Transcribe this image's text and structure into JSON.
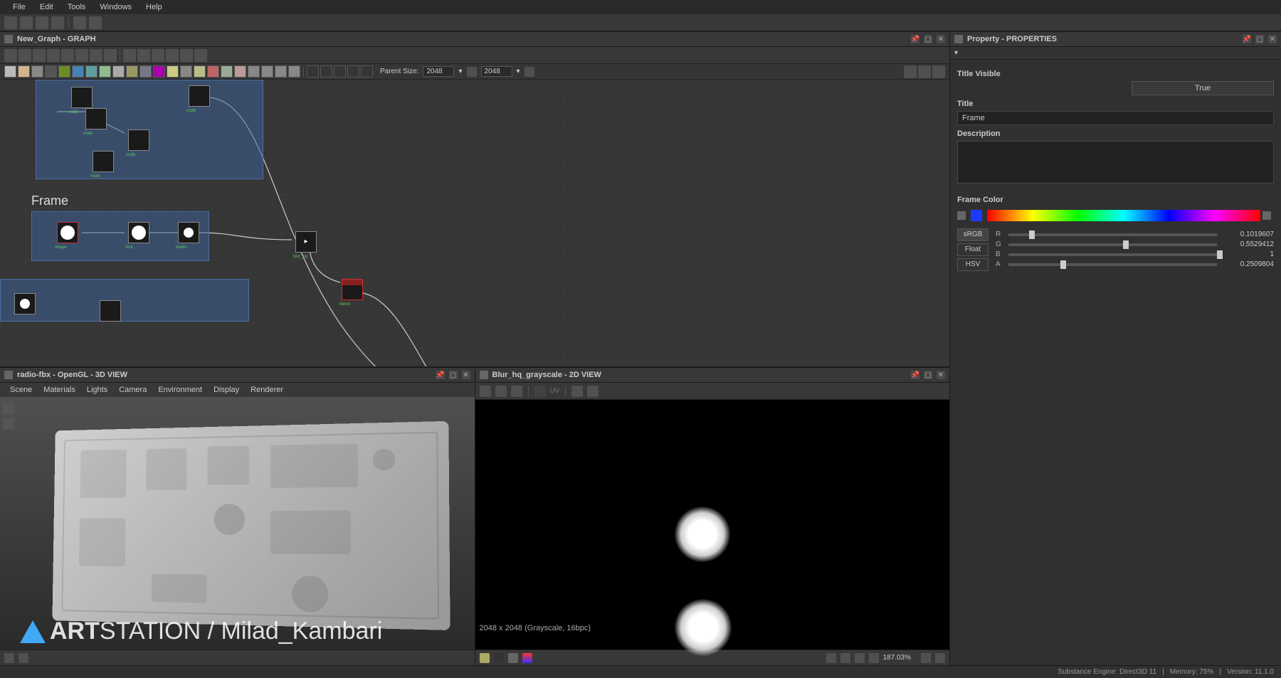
{
  "menubar": [
    "File",
    "Edit",
    "Tools",
    "Windows",
    "Help"
  ],
  "graph": {
    "title": "New_Graph - GRAPH",
    "parent_size_label": "Parent Size:",
    "size_w": "2048",
    "size_h": "2048",
    "frame_title": "Frame"
  },
  "view3d": {
    "title": "radio-fbx - OpenGL - 3D VIEW",
    "menus": [
      "Scene",
      "Materials",
      "Lights",
      "Camera",
      "Environment",
      "Display",
      "Renderer"
    ],
    "watermark_bold": "ART",
    "watermark_rest": "STATION / Milad_Kambari"
  },
  "view2d": {
    "title": "Blur_hq_grayscale - 2D VIEW",
    "info": "2048 x 2048 (Grayscale, 16bpc)",
    "uv_label": "UV",
    "zoom": "187.03%"
  },
  "properties": {
    "title": "Property - PROPERTIES",
    "title_visible_label": "Title Visible",
    "title_visible_value": "True",
    "title_label": "Title",
    "title_value": "Frame",
    "description_label": "Description",
    "description_value": "",
    "frame_color_label": "Frame Color",
    "modes": {
      "srgb": "sRGB",
      "float": "Float",
      "hsv": "HSV"
    },
    "channels": {
      "r": {
        "label": "R",
        "value": "0.1019607",
        "pos": 10
      },
      "g": {
        "label": "G",
        "value": "0.5529412",
        "pos": 55
      },
      "b": {
        "label": "B",
        "value": "1",
        "pos": 100
      },
      "a": {
        "label": "A",
        "value": "0.2509804",
        "pos": 25
      }
    }
  },
  "statusbar": {
    "engine": "Substance Engine: Direct3D 11",
    "memory": "Memory: 75%",
    "version": "Version: 11.1.0"
  }
}
